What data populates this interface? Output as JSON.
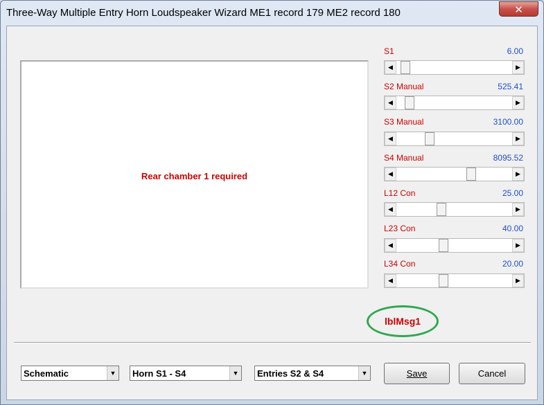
{
  "window": {
    "title": "Three-Way Multiple Entry Horn Loudspeaker Wizard   ME1 record 179   ME2 record 180",
    "close_label": "✕"
  },
  "canvas": {
    "message": "Rear chamber 1 required"
  },
  "sliders": [
    {
      "label": "S1",
      "value": "6.00",
      "position": 0.04
    },
    {
      "label": "S2  Manual",
      "value": "525.41",
      "position": 0.08
    },
    {
      "label": "S3  Manual",
      "value": "3100.00",
      "position": 0.27
    },
    {
      "label": "S4  Manual",
      "value": "8095.52",
      "position": 0.66
    },
    {
      "label": "L12  Con",
      "value": "25.00",
      "position": 0.38
    },
    {
      "label": "L23  Con",
      "value": "40.00",
      "position": 0.4
    },
    {
      "label": "L34  Con",
      "value": "20.00",
      "position": 0.4
    }
  ],
  "status_label": "lblMsg1",
  "combos": {
    "view": "Schematic",
    "horn": "Horn S1 - S4",
    "entries": "Entries S2 & S4"
  },
  "buttons": {
    "save": "Save",
    "cancel": "Cancel"
  },
  "colors": {
    "label_red": "#cc0000",
    "value_blue": "#1f4fcf",
    "highlight_green": "#2fa84f"
  }
}
